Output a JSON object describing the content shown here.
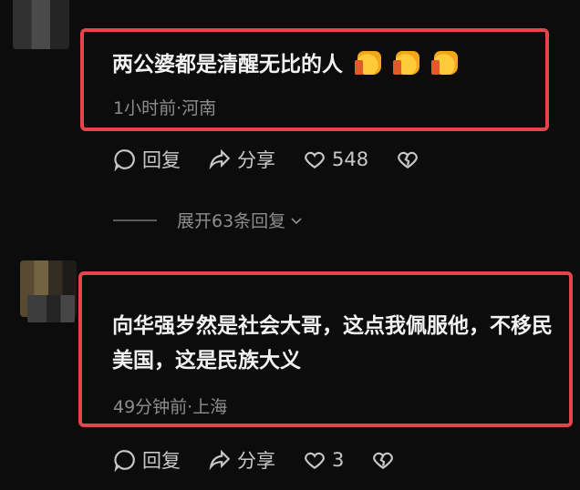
{
  "comments": [
    {
      "text": "两公婆都是清醒无比的人",
      "meta": "1小时前·河南",
      "reply_label": "回复",
      "share_label": "分享",
      "likes": "548",
      "emoji": [
        "thumbs-up",
        "thumbs-up",
        "thumbs-up"
      ]
    },
    {
      "text": "向华强岁然是社会大哥，这点我佩服他，不移民美国，这是民族大义",
      "meta": "49分钟前·上海",
      "reply_label": "回复",
      "share_label": "分享",
      "likes": "3"
    }
  ],
  "expand_replies": "展开63条回复",
  "colors": {
    "highlight": "#e6444d",
    "background": "#0c0c0d"
  }
}
